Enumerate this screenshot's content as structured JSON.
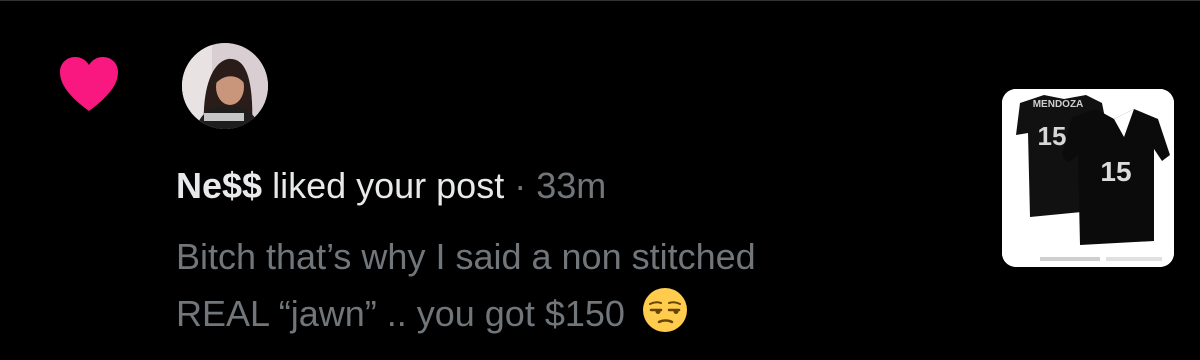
{
  "notification": {
    "type_icon": "heart-icon",
    "accent_color": "#f91880",
    "username": "Ne$$",
    "action": "liked your post",
    "separator": "·",
    "time": "33m",
    "post_text_line1": "Bitch that’s why I said a non stitched",
    "post_text_line2": "REAL “jawn” .. you got $150",
    "post_emoji": "unamused-face-emoji",
    "thumbnail": {
      "jersey_name": "MENDOZA",
      "jersey_number_back": "15",
      "jersey_number_front": "15"
    }
  }
}
